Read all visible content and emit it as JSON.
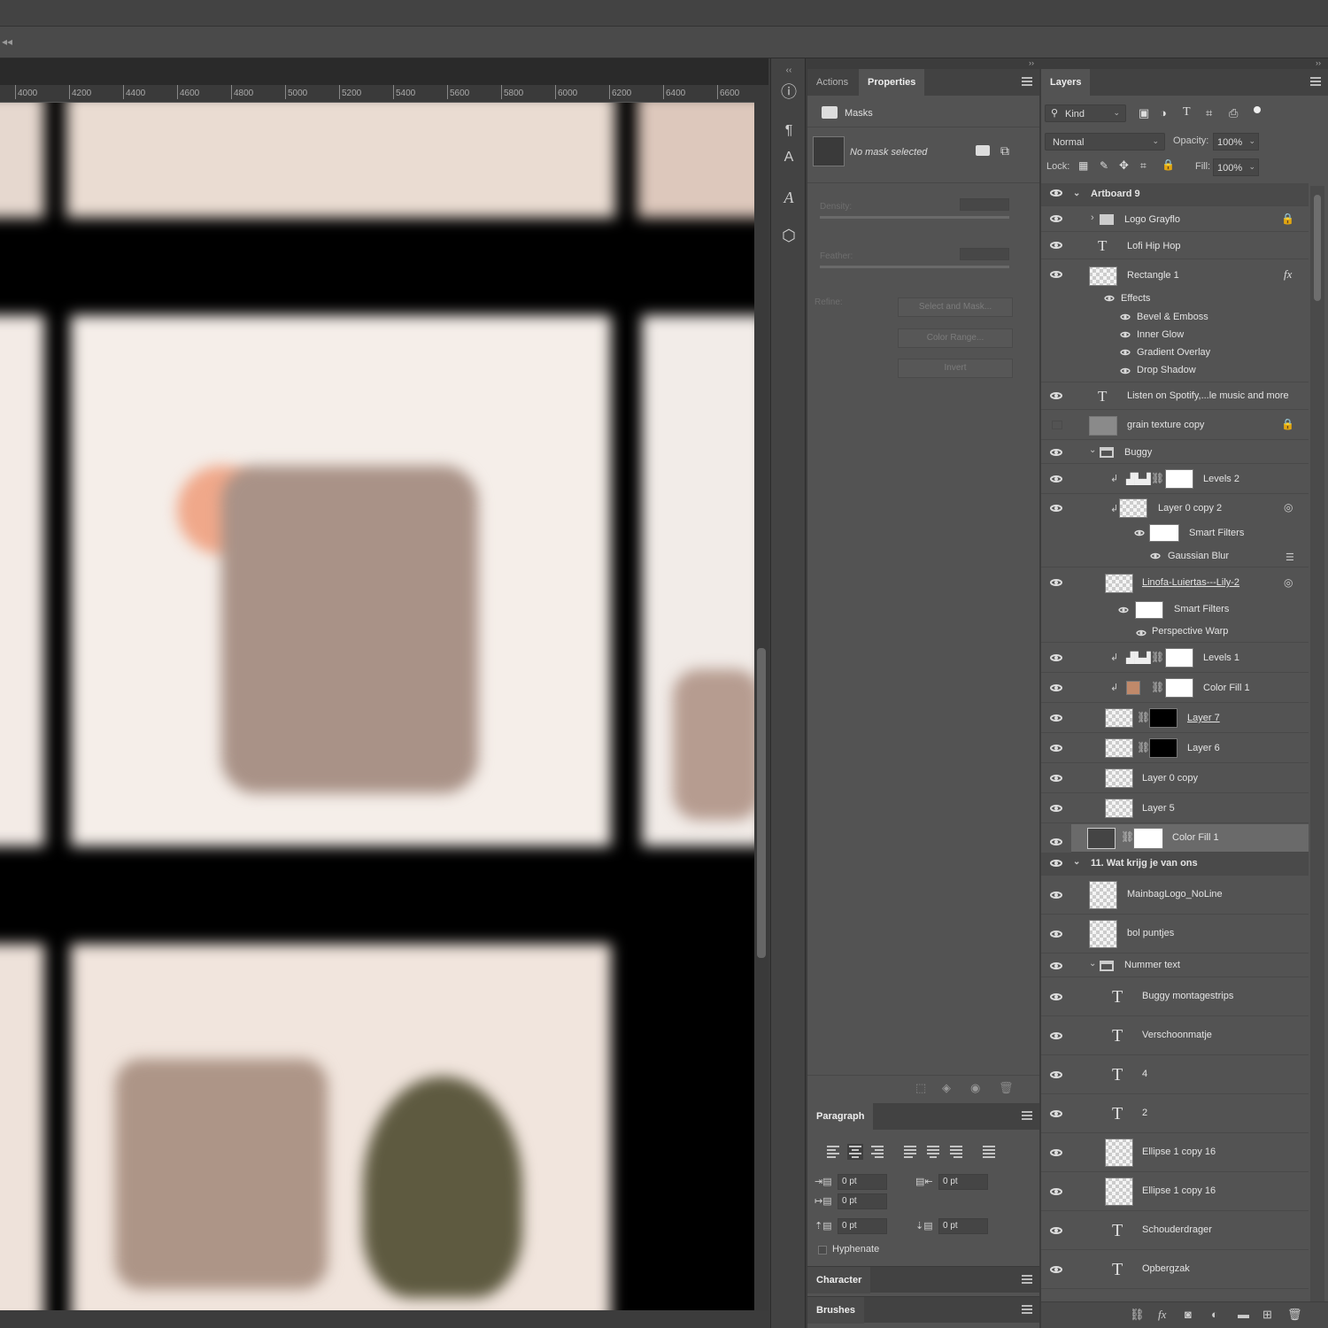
{
  "ruler": {
    "ticks": [
      "4000",
      "4200",
      "4400",
      "4600",
      "4800",
      "5000",
      "5200",
      "5400",
      "5600",
      "5800",
      "6000",
      "6200",
      "6400",
      "6600"
    ]
  },
  "props_panel": {
    "tabs": [
      {
        "label": "Actions"
      },
      {
        "label": "Properties"
      }
    ],
    "masks_label": "Masks",
    "no_mask": "No mask selected",
    "density_label": "Density:",
    "feather_label": "Feather:",
    "refine_label": "Refine:",
    "buttons": {
      "select_mask": "Select and Mask...",
      "color_range": "Color Range...",
      "invert": "Invert"
    }
  },
  "paragraph": {
    "title": "Paragraph",
    "indent_left": "0 pt",
    "indent_right": "0 pt",
    "first_line": "0 pt",
    "space_before": "0 pt",
    "space_after": "0 pt",
    "hyphenate": "Hyphenate"
  },
  "collapsed": {
    "character": "Character",
    "brushes": "Brushes"
  },
  "layers_panel": {
    "tab": "Layers",
    "filter_kind": "Kind",
    "blend_mode": "Normal",
    "opacity_label": "Opacity:",
    "opacity": "100%",
    "lock_label": "Lock:",
    "fill_label": "Fill:",
    "fill": "100%",
    "rows": {
      "artboard9": "Artboard 9",
      "logo": "Logo Grayflo",
      "lofi": "Lofi Hip Hop",
      "rect1": "Rectangle 1",
      "effects": "Effects",
      "bevel": "Bevel & Emboss",
      "inner_glow": "Inner Glow",
      "gradient": "Gradient Overlay",
      "drop_shadow": "Drop Shadow",
      "spotify": "Listen on Spotify,...le music and more",
      "grain": "grain texture copy",
      "buggy": "Buggy",
      "levels2": "Levels 2",
      "layer0copy2": "Layer 0 copy 2",
      "smart_filters_1": "Smart Filters",
      "gaussian": "Gaussian Blur",
      "linofa": "Linofa-Luiertas---Lily-2",
      "smart_filters_2": "Smart Filters",
      "perspective": "Perspective Warp",
      "levels1": "Levels 1",
      "colorfill1a": "Color Fill 1",
      "layer7": "Layer 7",
      "layer6": "Layer 6",
      "layer0copy": "Layer 0 copy",
      "layer5": "Layer 5",
      "colorfill1b": "Color Fill 1",
      "wat_krijg": "11. Wat krijg je van ons",
      "mainbag": "MainbagLogo_NoLine",
      "bol": "bol puntjes",
      "nummer": "Nummer text",
      "buggy_strips": "Buggy montagestrips",
      "verschoon": "Verschoonmatje",
      "num4": "4",
      "num2": "2",
      "ellipse_a": "Ellipse 1 copy 16",
      "ellipse_b": "Ellipse 1 copy 16",
      "schouder": "Schouderdrager",
      "opberg": "Opbergzak"
    }
  },
  "colors": {
    "panel": "#535353",
    "color_fill_swatch": "#c0896a"
  }
}
